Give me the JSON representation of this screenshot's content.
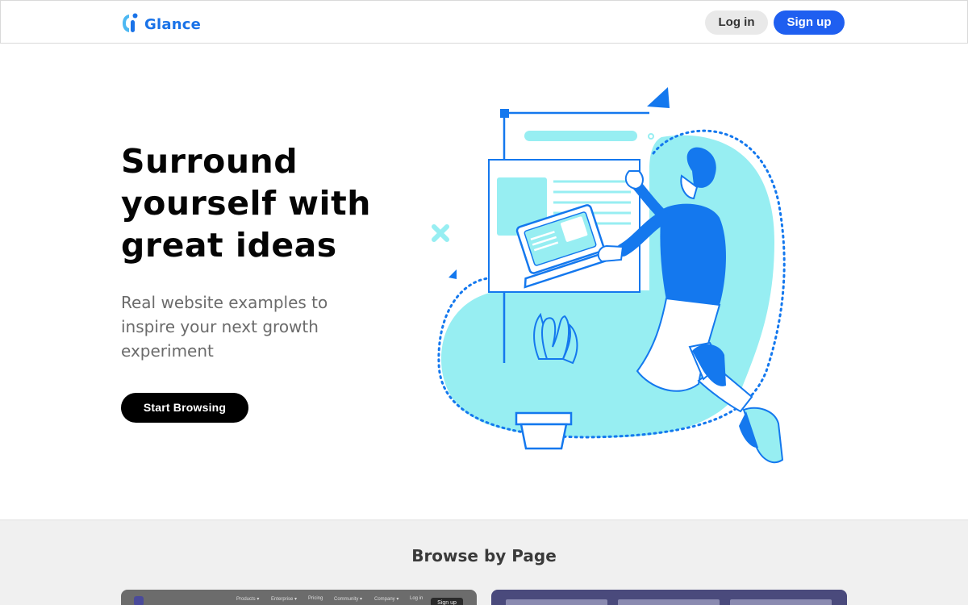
{
  "header": {
    "logo_text": "Glance",
    "login_label": "Log in",
    "signup_label": "Sign up"
  },
  "hero": {
    "title": "Surround yourself with great ideas",
    "subtitle": "Real website examples to inspire your next growth experiment",
    "cta_label": "Start Browsing"
  },
  "browse": {
    "title": "Browse by Page",
    "card_left_nav": [
      "Products ▾",
      "Enterprise ▾",
      "Pricing",
      "Community ▾",
      "Company ▾",
      "Log in"
    ],
    "card_left_signup": "Sign up"
  },
  "colors": {
    "brand_blue": "#1a73e8",
    "signup_blue": "#1f5ff0",
    "illustration_cyan": "#97eef2",
    "illustration_blue": "#1478ee"
  },
  "icons": {
    "logo": "glance-logo-icon"
  }
}
